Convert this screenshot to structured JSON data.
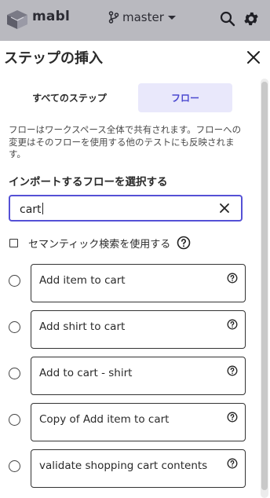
{
  "header": {
    "brand": "mabl",
    "branch": "master",
    "accent": "#5551d6",
    "bar_color": "#b9b9bf"
  },
  "dialog": {
    "title": "ステップの挿入",
    "tabs": [
      {
        "label": "すべてのステップ",
        "selected": false
      },
      {
        "label": "フロー",
        "selected": true
      }
    ],
    "description": "フローはワークスペース全体で共有されます。フローへの変更はそのフローを使用する他のテストにも反映されます。",
    "select_label": "インポートするフローを選択する",
    "search": {
      "value": "cart",
      "placeholder": ""
    },
    "semantic_search": {
      "label": "セマンティック検索を使用する",
      "checked": false
    },
    "flows": [
      {
        "name": "Add item to cart",
        "selected": false
      },
      {
        "name": "Add shirt to cart",
        "selected": false
      },
      {
        "name": "Add to cart - shirt",
        "selected": false
      },
      {
        "name": "Copy of Add item to cart",
        "selected": false
      },
      {
        "name": "validate shopping cart contents",
        "selected": false
      }
    ]
  },
  "icons": [
    "mabl-logo-icon",
    "branch-icon",
    "chevron-down-icon",
    "search-icon",
    "gear-icon",
    "close-icon",
    "clear-icon",
    "help-circle-icon"
  ]
}
